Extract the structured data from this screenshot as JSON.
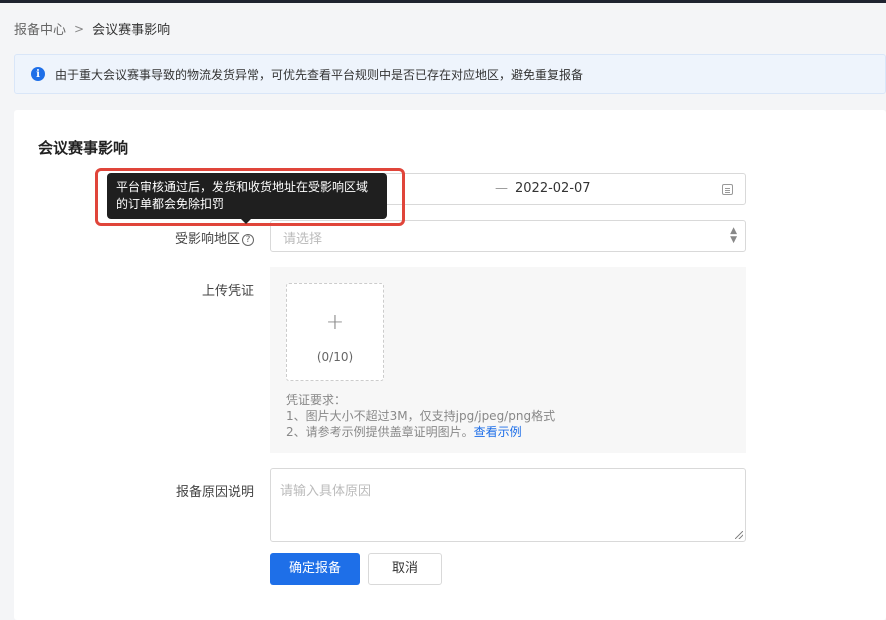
{
  "breadcrumb": {
    "parent": "报备中心",
    "separator": ">",
    "current": "会议赛事影响"
  },
  "notice": {
    "icon": "info-icon",
    "icon_glyph": "i",
    "text": "由于重大会议赛事导致的物流发货异常，可优先查看平台规则中是否已存在对应地区，避免重复报备"
  },
  "form": {
    "title": "会议赛事影响",
    "date_range": {
      "separator": "—",
      "end_value": "2022-02-07"
    },
    "region": {
      "label": "受影响地区",
      "help_glyph": "?",
      "placeholder": "请选择",
      "arrow_up": "▲",
      "arrow_down": "▼"
    },
    "upload": {
      "label": "上传凭证",
      "plus": "+",
      "count": "(0/10)",
      "requirements_title": "凭证要求：",
      "requirement_1": "1、图片大小不超过3M，仅支持jpg/jpeg/png格式",
      "requirement_2": "2、请参考示例提供盖章证明图片。",
      "example_link": "查看示例"
    },
    "reason": {
      "label": "报备原因说明",
      "placeholder": "请输入具体原因"
    },
    "submit_label": "确定报备",
    "cancel_label": "取消"
  },
  "tooltip": {
    "text": "平台审核通过后，发货和收货地址在受影响区域的订单都会免除扣罚"
  },
  "colors": {
    "accent": "#1e6fe8",
    "highlight": "#e0453a"
  }
}
